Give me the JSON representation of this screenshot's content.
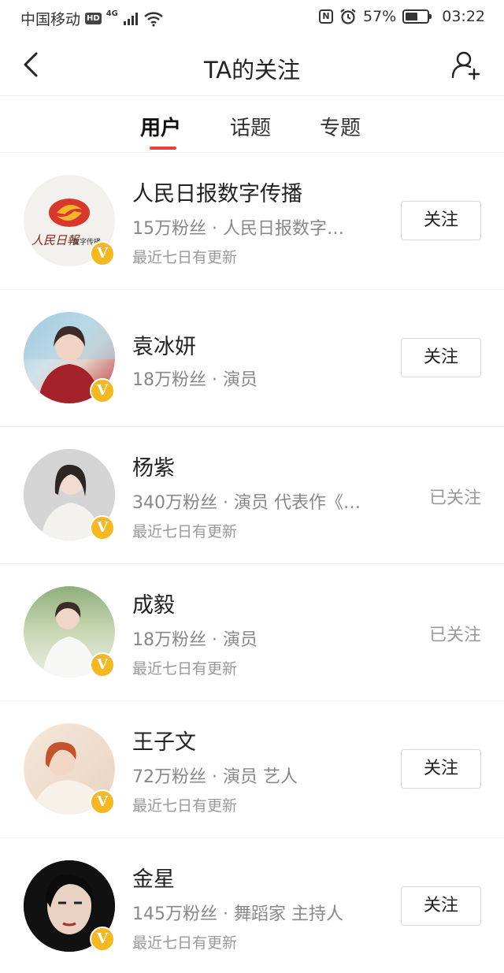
{
  "status_bar": {
    "carrier": "中国移动",
    "hd": "HD",
    "network": "4G",
    "battery_percent": "57%",
    "battery_level": 0.57,
    "time": "03:22"
  },
  "header": {
    "title": "TA的关注",
    "back_icon": "chevron-left-icon",
    "add_icon": "add-user-icon"
  },
  "tabs": [
    {
      "label": "用户",
      "active": true
    },
    {
      "label": "话题",
      "active": false
    },
    {
      "label": "专题",
      "active": false
    }
  ],
  "colors": {
    "accent": "#e8413c",
    "verified_badge": "#f5b821"
  },
  "verified_mark": "V",
  "users": [
    {
      "name": "人民日报数字传播",
      "desc": "15万粉丝 · 人民日报数字…",
      "update": "最近七日有更新",
      "action": "关注",
      "followed": false
    },
    {
      "name": "袁冰妍",
      "desc": "18万粉丝 · 演员",
      "update": "",
      "action": "关注",
      "followed": false
    },
    {
      "name": "杨紫",
      "desc": "340万粉丝 · 演员 代表作《…",
      "update": "最近七日有更新",
      "action": "已关注",
      "followed": true
    },
    {
      "name": "成毅",
      "desc": "18万粉丝 · 演员",
      "update": "最近七日有更新",
      "action": "已关注",
      "followed": true
    },
    {
      "name": "王子文",
      "desc": "72万粉丝 · 演员 艺人",
      "update": "最近七日有更新",
      "action": "关注",
      "followed": false
    },
    {
      "name": "金星",
      "desc": "145万粉丝 · 舞蹈家 主持人",
      "update": "最近七日有更新",
      "action": "关注",
      "followed": false
    }
  ],
  "logo_text": {
    "script": "人民日報",
    "sub": "数字传播"
  }
}
